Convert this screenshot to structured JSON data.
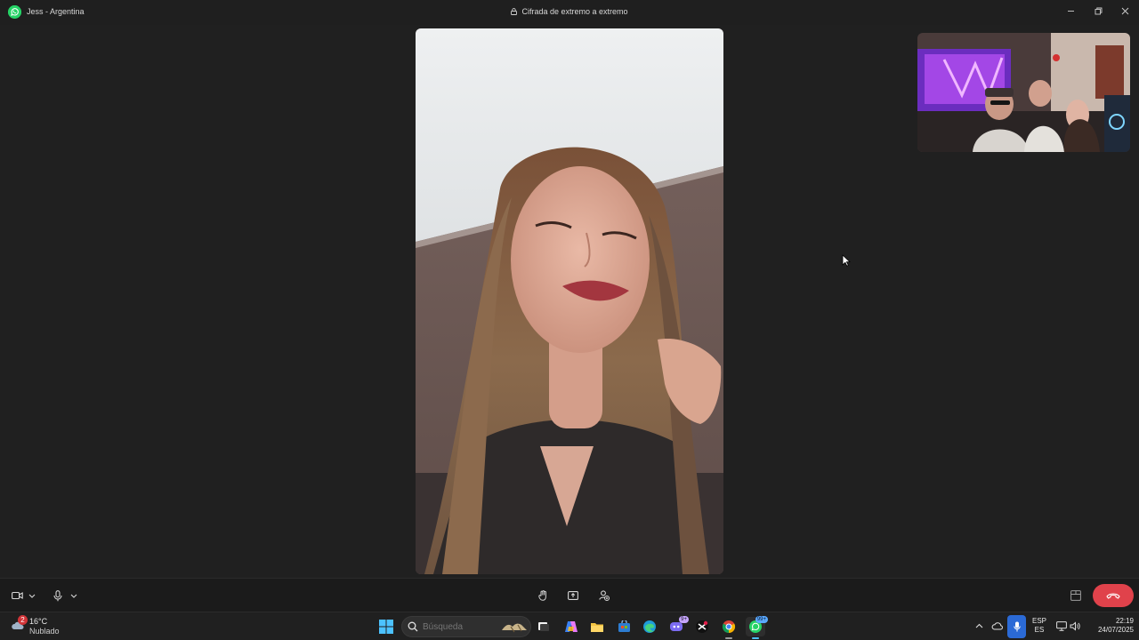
{
  "window": {
    "contact_name": "Jess - Argentina",
    "encryption_label": "Cifrada de extremo a extremo"
  },
  "icons": {
    "app": "whatsapp-icon",
    "lock": "lock-icon",
    "minimize": "minimize-icon",
    "restore": "restore-icon",
    "close": "close-icon",
    "camera": "camera-icon",
    "microphone": "microphone-icon",
    "raise_hand": "raise-hand-icon",
    "share_screen": "share-screen-icon",
    "add_person": "add-person-icon",
    "layout": "layout-icon",
    "end_call": "end-call-icon"
  },
  "colors": {
    "whatsapp_green": "#25d366",
    "end_call_red": "#e0424b",
    "stage_background": "#202020",
    "taskbar_background": "#202020"
  },
  "taskbar": {
    "weather": {
      "badge": "2",
      "temperature": "16°C",
      "condition": "Nublado"
    },
    "search_placeholder": "Búsqueda",
    "apps": [
      {
        "name": "task-view"
      },
      {
        "name": "copilot"
      },
      {
        "name": "file-explorer"
      },
      {
        "name": "microsoft-store"
      },
      {
        "name": "edge"
      },
      {
        "name": "discord",
        "badge": "9+"
      },
      {
        "name": "capcut"
      },
      {
        "name": "chrome"
      },
      {
        "name": "whatsapp",
        "badge": "99+"
      }
    ],
    "language": {
      "primary": "ESP",
      "secondary": "ES"
    },
    "clock": {
      "time": "22:19",
      "date": "24/07/2025"
    }
  }
}
